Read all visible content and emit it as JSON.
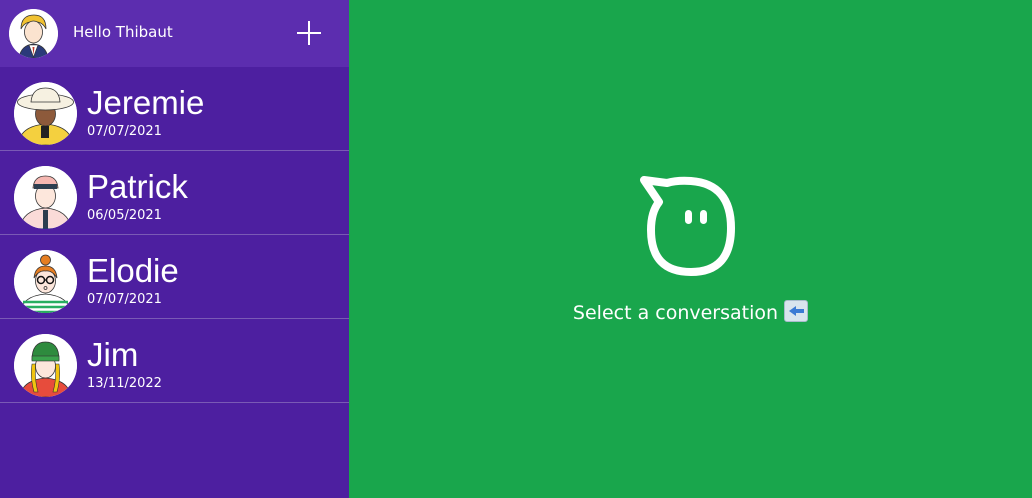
{
  "sidebar": {
    "header": {
      "greeting": "Hello Thibaut",
      "avatar_icon": "user-avatar-icon",
      "add_icon": "plus-icon"
    },
    "conversations": [
      {
        "name": "Jeremie",
        "date": "07/07/2021",
        "avatar": "avatar-sunhat"
      },
      {
        "name": "Patrick",
        "date": "06/05/2021",
        "avatar": "avatar-cap"
      },
      {
        "name": "Elodie",
        "date": "07/07/2021",
        "avatar": "avatar-glasses"
      },
      {
        "name": "Jim",
        "date": "13/11/2022",
        "avatar": "avatar-beanie"
      }
    ]
  },
  "main": {
    "empty_state_text": "Select a conversation",
    "empty_state_icon": "chat-bubble-icon",
    "arrow_icon": "left-arrow-icon"
  },
  "colors": {
    "sidebar": "#4d1fa0",
    "header": "#5c2daf",
    "main": "#19a64c"
  }
}
